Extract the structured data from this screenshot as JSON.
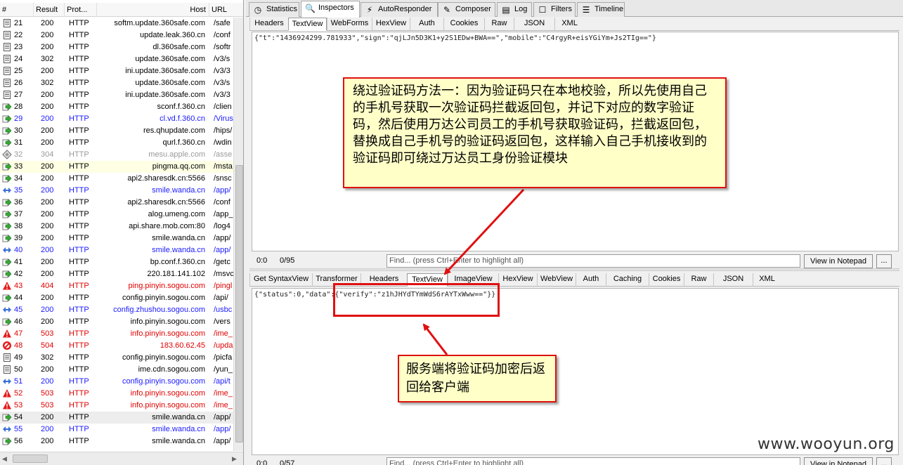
{
  "columns": {
    "num": "#",
    "result": "Result",
    "protocol": "Prot...",
    "host": "Host",
    "url": "URL"
  },
  "sessions": [
    {
      "num": "21",
      "result": "200",
      "protocol": "HTTP",
      "host": "softm.update.360safe.com",
      "url": "/safe",
      "style": "black",
      "icon": "doc"
    },
    {
      "num": "22",
      "result": "200",
      "protocol": "HTTP",
      "host": "update.leak.360.cn",
      "url": "/conf",
      "style": "black",
      "icon": "doc"
    },
    {
      "num": "23",
      "result": "200",
      "protocol": "HTTP",
      "host": "dl.360safe.com",
      "url": "/softr",
      "style": "black",
      "icon": "doc"
    },
    {
      "num": "24",
      "result": "302",
      "protocol": "HTTP",
      "host": "update.360safe.com",
      "url": "/v3/s",
      "style": "black",
      "icon": "doc"
    },
    {
      "num": "25",
      "result": "200",
      "protocol": "HTTP",
      "host": "ini.update.360safe.com",
      "url": "/v3/3",
      "style": "black",
      "icon": "doc"
    },
    {
      "num": "26",
      "result": "302",
      "protocol": "HTTP",
      "host": "update.360safe.com",
      "url": "/v3/s",
      "style": "black",
      "icon": "doc"
    },
    {
      "num": "27",
      "result": "200",
      "protocol": "HTTP",
      "host": "ini.update.360safe.com",
      "url": "/v3/3",
      "style": "black",
      "icon": "doc"
    },
    {
      "num": "28",
      "result": "200",
      "protocol": "HTTP",
      "host": "sconf.f.360.cn",
      "url": "/clien",
      "style": "black",
      "icon": "arrow"
    },
    {
      "num": "29",
      "result": "200",
      "protocol": "HTTP",
      "host": "cl.vd.f.360.cn",
      "url": "/Virus",
      "style": "blue",
      "icon": "arrow"
    },
    {
      "num": "30",
      "result": "200",
      "protocol": "HTTP",
      "host": "res.qhupdate.com",
      "url": "/hips/",
      "style": "black",
      "icon": "arrow"
    },
    {
      "num": "31",
      "result": "200",
      "protocol": "HTTP",
      "host": "qurl.f.360.cn",
      "url": "/wdin",
      "style": "black",
      "icon": "arrow"
    },
    {
      "num": "32",
      "result": "304",
      "protocol": "HTTP",
      "host": "mesu.apple.com",
      "url": "/asse",
      "style": "gray",
      "icon": "diamond"
    },
    {
      "num": "33",
      "result": "200",
      "protocol": "HTTP",
      "host": "pingma.qq.com",
      "url": "/msta",
      "style": "black",
      "icon": "arrow",
      "hl": true
    },
    {
      "num": "34",
      "result": "200",
      "protocol": "HTTP",
      "host": "api2.sharesdk.cn:5566",
      "url": "/snsc",
      "style": "black",
      "icon": "arrow"
    },
    {
      "num": "35",
      "result": "200",
      "protocol": "HTTP",
      "host": "smile.wanda.cn",
      "url": "/app/",
      "style": "blue",
      "icon": "twoway"
    },
    {
      "num": "36",
      "result": "200",
      "protocol": "HTTP",
      "host": "api2.sharesdk.cn:5566",
      "url": "/conf",
      "style": "black",
      "icon": "arrow"
    },
    {
      "num": "37",
      "result": "200",
      "protocol": "HTTP",
      "host": "alog.umeng.com",
      "url": "/app_",
      "style": "black",
      "icon": "arrow"
    },
    {
      "num": "38",
      "result": "200",
      "protocol": "HTTP",
      "host": "api.share.mob.com:80",
      "url": "/log4",
      "style": "black",
      "icon": "arrow"
    },
    {
      "num": "39",
      "result": "200",
      "protocol": "HTTP",
      "host": "smile.wanda.cn",
      "url": "/app/",
      "style": "black",
      "icon": "arrow"
    },
    {
      "num": "40",
      "result": "200",
      "protocol": "HTTP",
      "host": "smile.wanda.cn",
      "url": "/app/",
      "style": "blue",
      "icon": "twoway"
    },
    {
      "num": "41",
      "result": "200",
      "protocol": "HTTP",
      "host": "bp.conf.f.360.cn",
      "url": "/getc",
      "style": "black",
      "icon": "arrow"
    },
    {
      "num": "42",
      "result": "200",
      "protocol": "HTTP",
      "host": "220.181.141.102",
      "url": "/msvc",
      "style": "black",
      "icon": "arrow"
    },
    {
      "num": "43",
      "result": "404",
      "protocol": "HTTP",
      "host": "ping.pinyin.sogou.com",
      "url": "/pingl",
      "style": "red",
      "icon": "warn"
    },
    {
      "num": "44",
      "result": "200",
      "protocol": "HTTP",
      "host": "config.pinyin.sogou.com",
      "url": "/api/",
      "style": "black",
      "icon": "arrow"
    },
    {
      "num": "45",
      "result": "200",
      "protocol": "HTTP",
      "host": "config.zhushou.sogou.com",
      "url": "/usbc",
      "style": "blue",
      "icon": "twoway"
    },
    {
      "num": "46",
      "result": "200",
      "protocol": "HTTP",
      "host": "info.pinyin.sogou.com",
      "url": "/vers",
      "style": "black",
      "icon": "arrow"
    },
    {
      "num": "47",
      "result": "503",
      "protocol": "HTTP",
      "host": "info.pinyin.sogou.com",
      "url": "/ime_",
      "style": "red",
      "icon": "warn"
    },
    {
      "num": "48",
      "result": "504",
      "protocol": "HTTP",
      "host": "183.60.62.45",
      "url": "/upda",
      "style": "red",
      "icon": "block"
    },
    {
      "num": "49",
      "result": "302",
      "protocol": "HTTP",
      "host": "config.pinyin.sogou.com",
      "url": "/picfa",
      "style": "black",
      "icon": "doc"
    },
    {
      "num": "50",
      "result": "200",
      "protocol": "HTTP",
      "host": "ime.cdn.sogou.com",
      "url": "/yun_",
      "style": "black",
      "icon": "doc"
    },
    {
      "num": "51",
      "result": "200",
      "protocol": "HTTP",
      "host": "config.pinyin.sogou.com",
      "url": "/api/t",
      "style": "blue",
      "icon": "twoway"
    },
    {
      "num": "52",
      "result": "503",
      "protocol": "HTTP",
      "host": "info.pinyin.sogou.com",
      "url": "/ime_",
      "style": "red",
      "icon": "warn"
    },
    {
      "num": "53",
      "result": "503",
      "protocol": "HTTP",
      "host": "info.pinyin.sogou.com",
      "url": "/ime_",
      "style": "red",
      "icon": "warn"
    },
    {
      "num": "54",
      "result": "200",
      "protocol": "HTTP",
      "host": "smile.wanda.cn",
      "url": "/app/",
      "style": "black",
      "icon": "arrow",
      "sel": true
    },
    {
      "num": "55",
      "result": "200",
      "protocol": "HTTP",
      "host": "smile.wanda.cn",
      "url": "/app/",
      "style": "blue",
      "icon": "twoway"
    },
    {
      "num": "56",
      "result": "200",
      "protocol": "HTTP",
      "host": "smile.wanda.cn",
      "url": "/app/",
      "style": "black",
      "icon": "arrow"
    }
  ],
  "main_tabs": [
    {
      "label": "Statistics",
      "icon": "stopwatch-icon",
      "glyph": "◷"
    },
    {
      "label": "Inspectors",
      "icon": "inspect-icon",
      "glyph": "🔍",
      "active": true
    },
    {
      "label": "AutoResponder",
      "icon": "lightning-icon",
      "glyph": "⚡"
    },
    {
      "label": "Composer",
      "icon": "pencil-icon",
      "glyph": "✎"
    },
    {
      "label": "Log",
      "icon": "log-icon",
      "glyph": "▤"
    },
    {
      "label": "Filters",
      "icon": "checkbox-icon",
      "glyph": "☐"
    },
    {
      "label": "Timeline",
      "icon": "timeline-icon",
      "glyph": "☰"
    }
  ],
  "request_tabs": [
    "Headers",
    "TextView",
    "WebForms",
    "HexView",
    "Auth",
    "Cookies",
    "Raw",
    "JSON",
    "XML"
  ],
  "request_active": "TextView",
  "request_body": "{\"t\":\"1436924299.781933\",\"sign\":\"qjLJn5D3K1+y2S1EDw+BWA==\",\"mobile\":\"C4rgyR+eisYGiYm+Js2TIg==\"}",
  "request_status": {
    "pos": "0:0",
    "count": "0/95",
    "find_placeholder": "Find... (press Ctrl+Enter to highlight all)",
    "notepad": "View in Notepad",
    "more": "..."
  },
  "response_tabs": [
    "Get SyntaxView",
    "Transformer",
    "Headers",
    "TextView",
    "ImageView",
    "HexView",
    "WebView",
    "Auth",
    "Caching",
    "Cookies",
    "Raw",
    "JSON",
    "XML"
  ],
  "response_active": "TextView",
  "response_body": "{\"status\":0,\"data\":{\"verify\":\"z1hJHYdTYmWdS6rAYTxWww==\"}}",
  "response_status": {
    "pos": "0:0",
    "count": "0/57",
    "find_placeholder": "Find... (press Ctrl+Enter to highlight all)",
    "notepad": "View in Notepad",
    "more": "..."
  },
  "annotation_1": "绕过验证码方法一：因为验证码只在本地校验，所以先使用自己的手机号获取一次验证码拦截返回包，并记下对应的数字验证码，然后使用万达公司员工的手机号获取验证码，拦截返回包，替换成自己手机号的验证码返回包，这样输入自己手机接收到的验证码即可绕过万达员工身份验证模块",
  "annotation_2": "服务端将验证码加密后返回给客户端",
  "watermark": "www.wooyun.org",
  "colors": {
    "accent_red": "#e01010",
    "note_bg": "#ffffc8",
    "link_blue": "#1a1aff",
    "error_red": "#e00000"
  }
}
